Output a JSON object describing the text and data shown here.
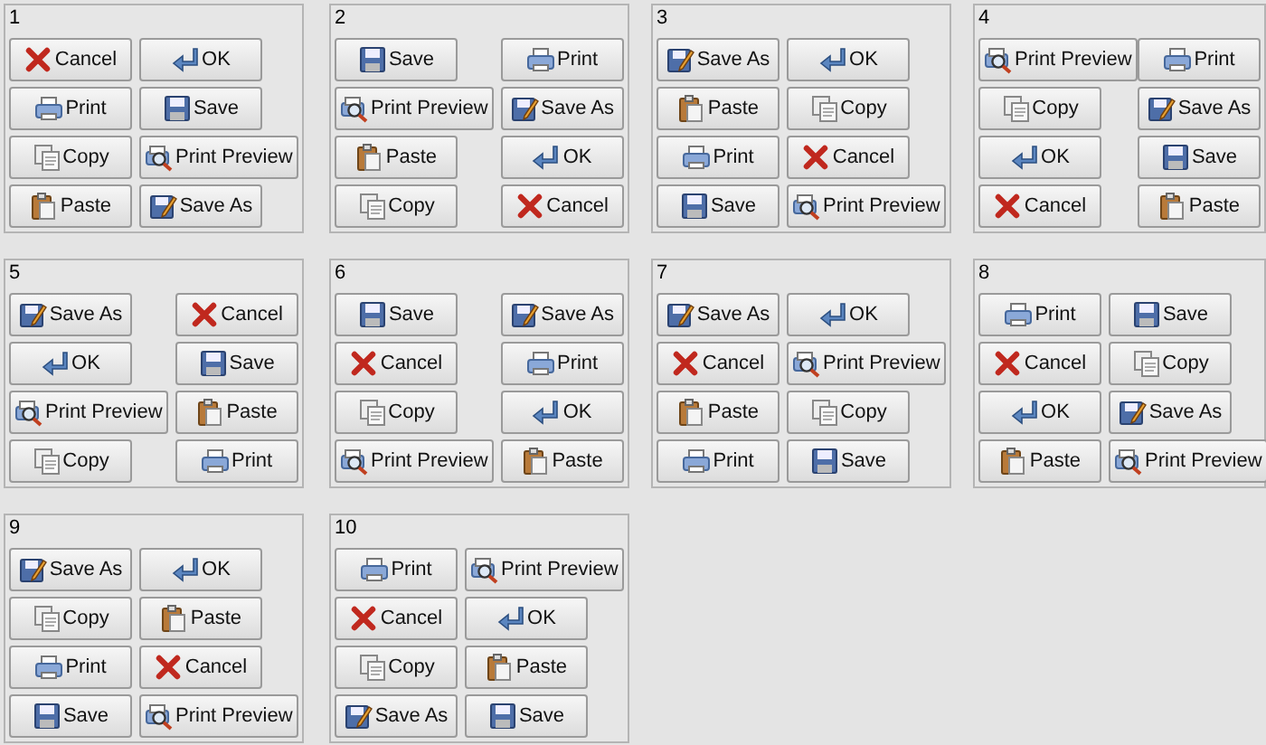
{
  "panels": [
    {
      "number": "1",
      "buttons": [
        {
          "kind": "cancel",
          "label": "Cancel"
        },
        {
          "kind": "ok",
          "label": "OK"
        },
        {
          "kind": "print",
          "label": "Print"
        },
        {
          "kind": "save",
          "label": "Save"
        },
        {
          "kind": "copy",
          "label": "Copy"
        },
        {
          "kind": "print-preview",
          "label": "Print Preview"
        },
        {
          "kind": "paste",
          "label": "Paste"
        },
        {
          "kind": "save-as",
          "label": "Save As"
        }
      ]
    },
    {
      "number": "2",
      "buttons": [
        {
          "kind": "save",
          "label": "Save"
        },
        {
          "kind": "print",
          "label": "Print"
        },
        {
          "kind": "print-preview",
          "label": "Print Preview"
        },
        {
          "kind": "save-as",
          "label": "Save As"
        },
        {
          "kind": "paste",
          "label": "Paste"
        },
        {
          "kind": "ok",
          "label": "OK"
        },
        {
          "kind": "copy",
          "label": "Copy"
        },
        {
          "kind": "cancel",
          "label": "Cancel"
        }
      ]
    },
    {
      "number": "3",
      "buttons": [
        {
          "kind": "save-as",
          "label": "Save As"
        },
        {
          "kind": "ok",
          "label": "OK"
        },
        {
          "kind": "paste",
          "label": "Paste"
        },
        {
          "kind": "copy",
          "label": "Copy"
        },
        {
          "kind": "print",
          "label": "Print"
        },
        {
          "kind": "cancel",
          "label": "Cancel"
        },
        {
          "kind": "save",
          "label": "Save"
        },
        {
          "kind": "print-preview",
          "label": "Print Preview"
        }
      ]
    },
    {
      "number": "4",
      "buttons": [
        {
          "kind": "print-preview",
          "label": "Print Preview"
        },
        {
          "kind": "print",
          "label": "Print"
        },
        {
          "kind": "copy",
          "label": "Copy"
        },
        {
          "kind": "save-as",
          "label": "Save As"
        },
        {
          "kind": "ok",
          "label": "OK"
        },
        {
          "kind": "save",
          "label": "Save"
        },
        {
          "kind": "cancel",
          "label": "Cancel"
        },
        {
          "kind": "paste",
          "label": "Paste"
        }
      ]
    },
    {
      "number": "5",
      "buttons": [
        {
          "kind": "save-as",
          "label": "Save As"
        },
        {
          "kind": "cancel",
          "label": "Cancel"
        },
        {
          "kind": "ok",
          "label": "OK"
        },
        {
          "kind": "save",
          "label": "Save"
        },
        {
          "kind": "print-preview",
          "label": "Print Preview"
        },
        {
          "kind": "paste",
          "label": "Paste"
        },
        {
          "kind": "copy",
          "label": "Copy"
        },
        {
          "kind": "print",
          "label": "Print"
        }
      ]
    },
    {
      "number": "6",
      "buttons": [
        {
          "kind": "save",
          "label": "Save"
        },
        {
          "kind": "save-as",
          "label": "Save As"
        },
        {
          "kind": "cancel",
          "label": "Cancel"
        },
        {
          "kind": "print",
          "label": "Print"
        },
        {
          "kind": "copy",
          "label": "Copy"
        },
        {
          "kind": "ok",
          "label": "OK"
        },
        {
          "kind": "print-preview",
          "label": "Print Preview"
        },
        {
          "kind": "paste",
          "label": "Paste"
        }
      ]
    },
    {
      "number": "7",
      "buttons": [
        {
          "kind": "save-as",
          "label": "Save As"
        },
        {
          "kind": "ok",
          "label": "OK"
        },
        {
          "kind": "cancel",
          "label": "Cancel"
        },
        {
          "kind": "print-preview",
          "label": "Print Preview"
        },
        {
          "kind": "paste",
          "label": "Paste"
        },
        {
          "kind": "copy",
          "label": "Copy"
        },
        {
          "kind": "print",
          "label": "Print"
        },
        {
          "kind": "save",
          "label": "Save"
        }
      ]
    },
    {
      "number": "8",
      "buttons": [
        {
          "kind": "print",
          "label": "Print"
        },
        {
          "kind": "save",
          "label": "Save"
        },
        {
          "kind": "cancel",
          "label": "Cancel"
        },
        {
          "kind": "copy",
          "label": "Copy"
        },
        {
          "kind": "ok",
          "label": "OK"
        },
        {
          "kind": "save-as",
          "label": "Save As"
        },
        {
          "kind": "paste",
          "label": "Paste"
        },
        {
          "kind": "print-preview",
          "label": "Print Preview"
        }
      ]
    },
    {
      "number": "9",
      "buttons": [
        {
          "kind": "save-as",
          "label": "Save As"
        },
        {
          "kind": "ok",
          "label": "OK"
        },
        {
          "kind": "copy",
          "label": "Copy"
        },
        {
          "kind": "paste",
          "label": "Paste"
        },
        {
          "kind": "print",
          "label": "Print"
        },
        {
          "kind": "cancel",
          "label": "Cancel"
        },
        {
          "kind": "save",
          "label": "Save"
        },
        {
          "kind": "print-preview",
          "label": "Print Preview"
        }
      ]
    },
    {
      "number": "10",
      "buttons": [
        {
          "kind": "print",
          "label": "Print"
        },
        {
          "kind": "print-preview",
          "label": "Print Preview"
        },
        {
          "kind": "cancel",
          "label": "Cancel"
        },
        {
          "kind": "ok",
          "label": "OK"
        },
        {
          "kind": "copy",
          "label": "Copy"
        },
        {
          "kind": "paste",
          "label": "Paste"
        },
        {
          "kind": "save-as",
          "label": "Save As"
        },
        {
          "kind": "save",
          "label": "Save"
        }
      ]
    }
  ]
}
